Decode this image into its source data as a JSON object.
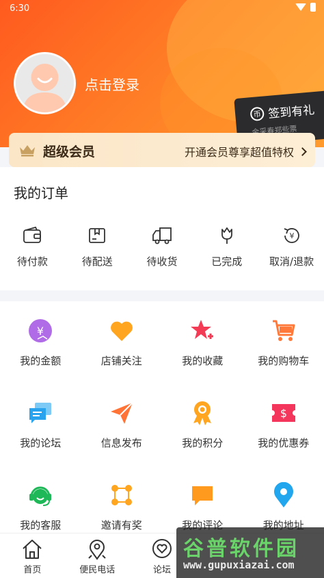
{
  "status_bar": {
    "time": "6:30"
  },
  "profile": {
    "login_label": "点击登录"
  },
  "checkin": {
    "label": "签到有礼",
    "sub": "金采春郑些票",
    "icon_text": "币"
  },
  "vip": {
    "title": "超级会员",
    "promo": "开通会员尊享超值特权"
  },
  "orders": {
    "title": "我的订单",
    "items": [
      {
        "label": "待付款",
        "icon": "wallet-icon"
      },
      {
        "label": "待配送",
        "icon": "package-icon"
      },
      {
        "label": "待收货",
        "icon": "truck-icon"
      },
      {
        "label": "已完成",
        "icon": "tulip-icon"
      },
      {
        "label": "取消/退款",
        "icon": "refund-icon"
      }
    ]
  },
  "services": {
    "items": [
      {
        "label": "我的金额",
        "icon": "yen-coin-icon",
        "color": "#b06ce6"
      },
      {
        "label": "店铺关注",
        "icon": "heart-icon",
        "color": "#ffa51f"
      },
      {
        "label": "我的收藏",
        "icon": "star-plus-icon",
        "color": "#f33b56"
      },
      {
        "label": "我的购物车",
        "icon": "cart-icon",
        "color": "#ff7a3a"
      },
      {
        "label": "我的论坛",
        "icon": "chat-bubbles-icon",
        "color": "#2aa3ee"
      },
      {
        "label": "信息发布",
        "icon": "paper-plane-icon",
        "color": "#ff7436"
      },
      {
        "label": "我的积分",
        "icon": "medal-icon",
        "color": "#ffa51f"
      },
      {
        "label": "我的优惠券",
        "icon": "coupon-icon",
        "color": "#f5365c"
      },
      {
        "label": "我的客服",
        "icon": "headset-icon",
        "color": "#1fb858"
      },
      {
        "label": "邀请有奖",
        "icon": "network-icon",
        "color": "#ffa51f"
      },
      {
        "label": "我的评论",
        "icon": "comment-icon",
        "color": "#ff9a1f"
      },
      {
        "label": "我的地址",
        "icon": "location-pin-icon",
        "color": "#22a6ee"
      }
    ]
  },
  "tabbar": {
    "items": [
      {
        "label": "首页",
        "icon": "home-icon"
      },
      {
        "label": "便民电话",
        "icon": "map-pin-icon"
      },
      {
        "label": "论坛",
        "icon": "heart-chat-icon"
      },
      {
        "label": "",
        "icon": ""
      },
      {
        "label": "",
        "icon": ""
      }
    ]
  },
  "watermark": {
    "title": "谷普软件园",
    "url": "www.gupuxiazai.com"
  },
  "colors": {
    "header_start": "#ff5a1f",
    "header_end": "#ff9b2e",
    "vip_bg": "#fbe6c7",
    "vip_text": "#3a2a17"
  }
}
